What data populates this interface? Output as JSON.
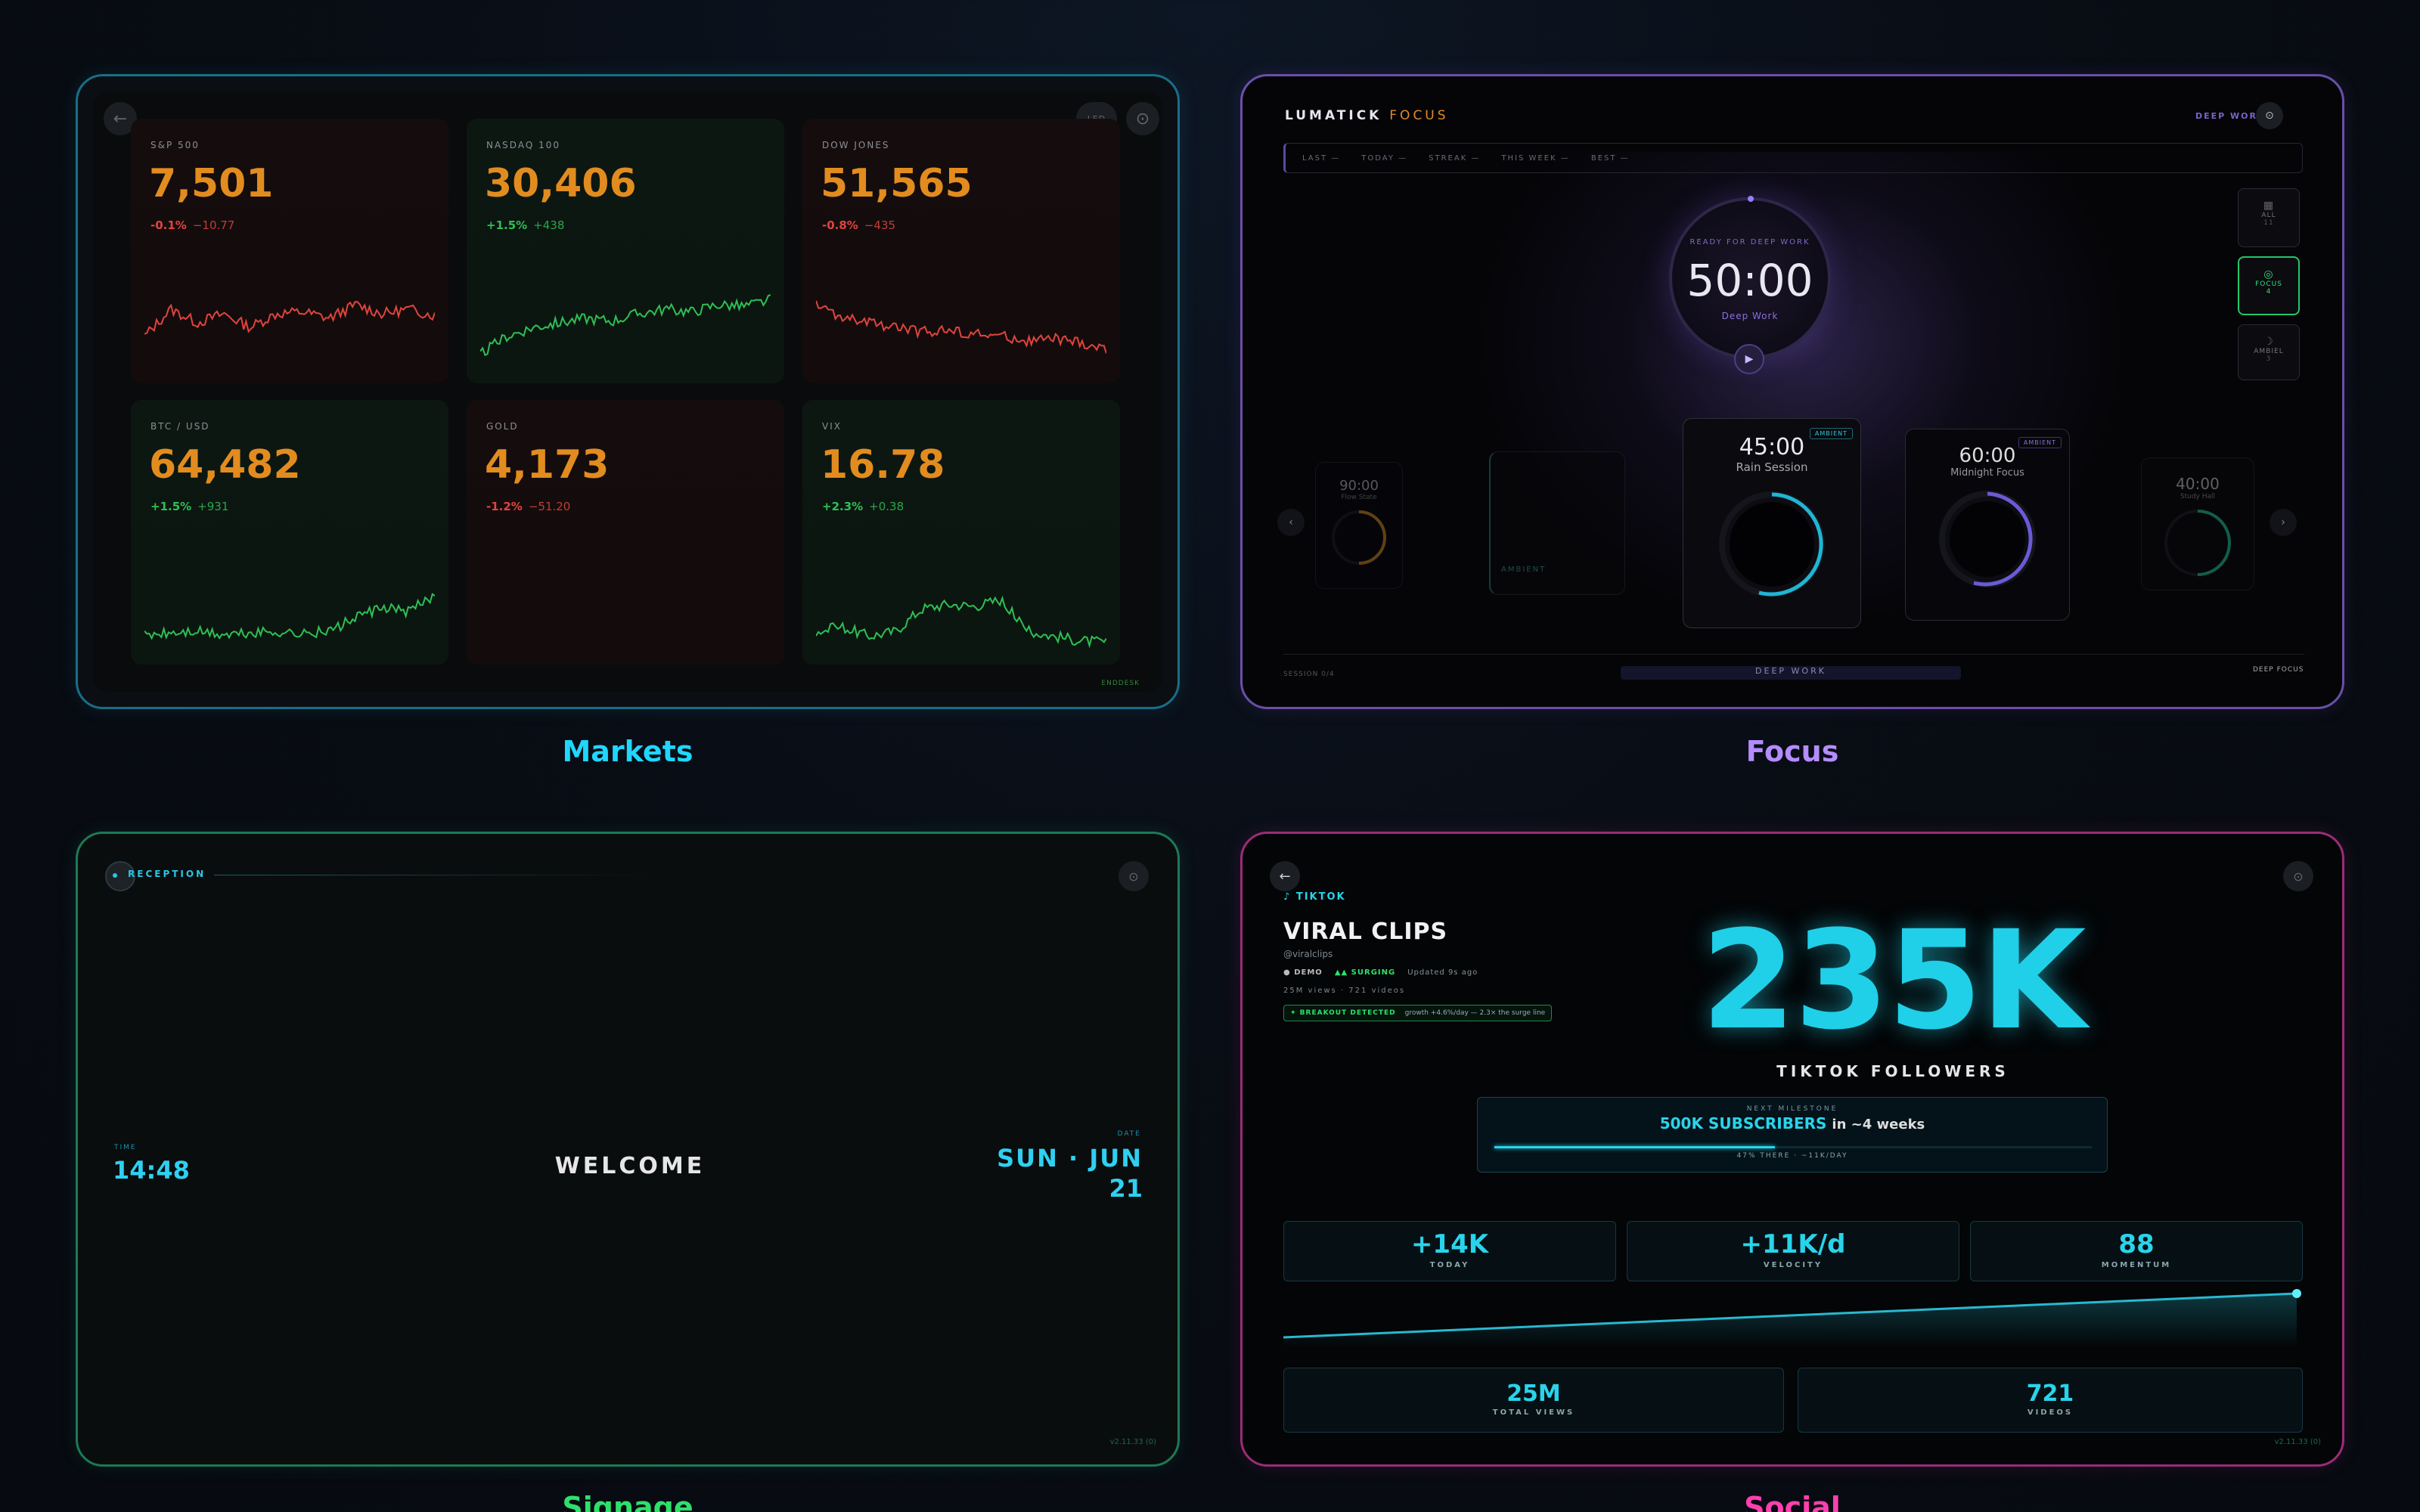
{
  "captions": {
    "markets": "Markets",
    "focus": "Focus",
    "signage": "Signage",
    "social": "Social"
  },
  "colors": {
    "markets": "#1fd6ff",
    "focus": "#b48cff",
    "signage": "#2ee06a",
    "social": "#ff3fb0",
    "up": "#2fbf55",
    "down": "#e0443e",
    "price": "#e28c1f"
  },
  "markets": {
    "back_icon": "arrow-left-icon",
    "led_label": "LED",
    "settings_icon": "gear-icon",
    "footer": "ENDDESK",
    "tickers": [
      {
        "symbol": "S&P 500",
        "price": "7,501",
        "pct": "-0.1%",
        "abs": "−10.77",
        "dir": "down"
      },
      {
        "symbol": "NASDAQ 100",
        "price": "30,406",
        "pct": "+1.5%",
        "abs": "+438",
        "dir": "up"
      },
      {
        "symbol": "DOW JONES",
        "price": "51,565",
        "pct": "-0.8%",
        "abs": "−435",
        "dir": "down"
      },
      {
        "symbol": "BTC / USD",
        "price": "64,482",
        "pct": "+1.5%",
        "abs": "+931",
        "dir": "up"
      },
      {
        "symbol": "GOLD",
        "price": "4,173",
        "pct": "-1.2%",
        "abs": "−51.20",
        "dir": "down"
      },
      {
        "symbol": "VIX",
        "price": "16.78",
        "pct": "+2.3%",
        "abs": "+0.38",
        "dir": "up"
      }
    ]
  },
  "focus": {
    "brand": "LUMATICK",
    "brand_accent": "FOCUS",
    "mode_label": "DEEP WORK",
    "stats": [
      "LAST —",
      "TODAY —",
      "STREAK —",
      "THIS WEEK —",
      "BEST —"
    ],
    "timer_caption": "READY FOR DEEP WORK",
    "timer_value": "50:00",
    "timer_sub": "Deep Work",
    "side_buttons": [
      {
        "label": "ALL",
        "sub": "11"
      },
      {
        "label": "FOCUS",
        "sub": "4"
      },
      {
        "label": "AMBIEL",
        "sub": "3"
      }
    ],
    "presets": [
      {
        "time": "90:00",
        "name": "Flow State"
      },
      {
        "time": "",
        "name": "AMBIENT"
      },
      {
        "time": "45:00",
        "name": "Rain Session",
        "badge": "AMBIENT"
      },
      {
        "time": "60:00",
        "name": "Midnight Focus",
        "badge": "AMBIENT"
      },
      {
        "time": "40:00",
        "name": "Study Hall"
      }
    ],
    "session_label": "SESSION 0/4",
    "bottom_bar_label": "DEEP WORK",
    "deep_focus": "DEEP FOCUS"
  },
  "signage": {
    "reception": "RECEPTION",
    "time_label": "TIME",
    "time_value": "14:48",
    "welcome": "WELCOME",
    "date_label": "DATE",
    "date_line1": "SUN · JUN",
    "date_line2": "21",
    "version": "v2.11.33 (0)"
  },
  "social": {
    "platform": "TIKTOK",
    "account_name": "VIRAL CLIPS",
    "handle": "@viralclips",
    "demo": "DEMO",
    "surging": "▲▲ SURGING",
    "updated": "Updated 9s ago",
    "meta": "25M views · 721 videos",
    "breakout": "✦ BREAKOUT DETECTED",
    "breakout_detail": "growth +4.6%/day — 2.3× the surge line",
    "followers_value": "235K",
    "followers_label": "TIKTOK FOLLOWERS",
    "milestone_label": "NEXT MILESTONE",
    "milestone_goal": "500K SUBSCRIBERS",
    "milestone_eta": "in ~4 weeks",
    "milestone_progress": 0.47,
    "milestone_sub": "47% THERE · ~11K/DAY",
    "stats": [
      {
        "value": "+14K",
        "label": "TODAY"
      },
      {
        "value": "+11K/d",
        "label": "VELOCITY"
      },
      {
        "value": "88",
        "label": "MOMENTUM"
      }
    ],
    "totals": [
      {
        "value": "25M",
        "label": "TOTAL VIEWS"
      },
      {
        "value": "721",
        "label": "VIDEOS"
      }
    ],
    "version": "v2.11.33 (0)"
  }
}
